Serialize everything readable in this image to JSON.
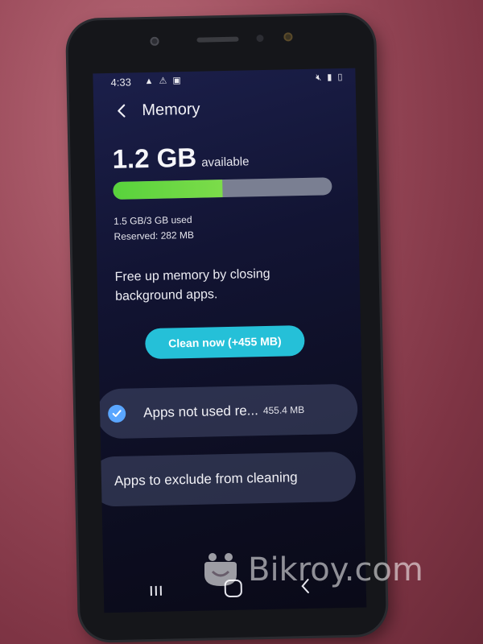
{
  "status_bar": {
    "time": "4:33",
    "left_icons": [
      "triangle-icon",
      "warning-icon",
      "image-icon"
    ],
    "right_icons": [
      "mute-icon",
      "signal-icon",
      "battery-icon"
    ]
  },
  "header": {
    "title": "Memory"
  },
  "memory": {
    "available_value": "1.2 GB",
    "available_label": "available",
    "used_text": "1.5 GB/3 GB used",
    "reserved_text": "Reserved: 282 MB",
    "used_fraction": 0.5,
    "bar_fill_color": "#5cd43e",
    "bar_track_color": "#7a7f92"
  },
  "description": "Free up memory by closing background apps.",
  "clean_button": {
    "label": "Clean now (+455 MB)",
    "color": "#25c0d8"
  },
  "options": [
    {
      "label": "Apps not used re...",
      "size": "455.4 MB",
      "checked": true
    },
    {
      "label": "Apps to exclude from cleaning"
    }
  ],
  "watermark": {
    "text": "Bikroy.com"
  }
}
